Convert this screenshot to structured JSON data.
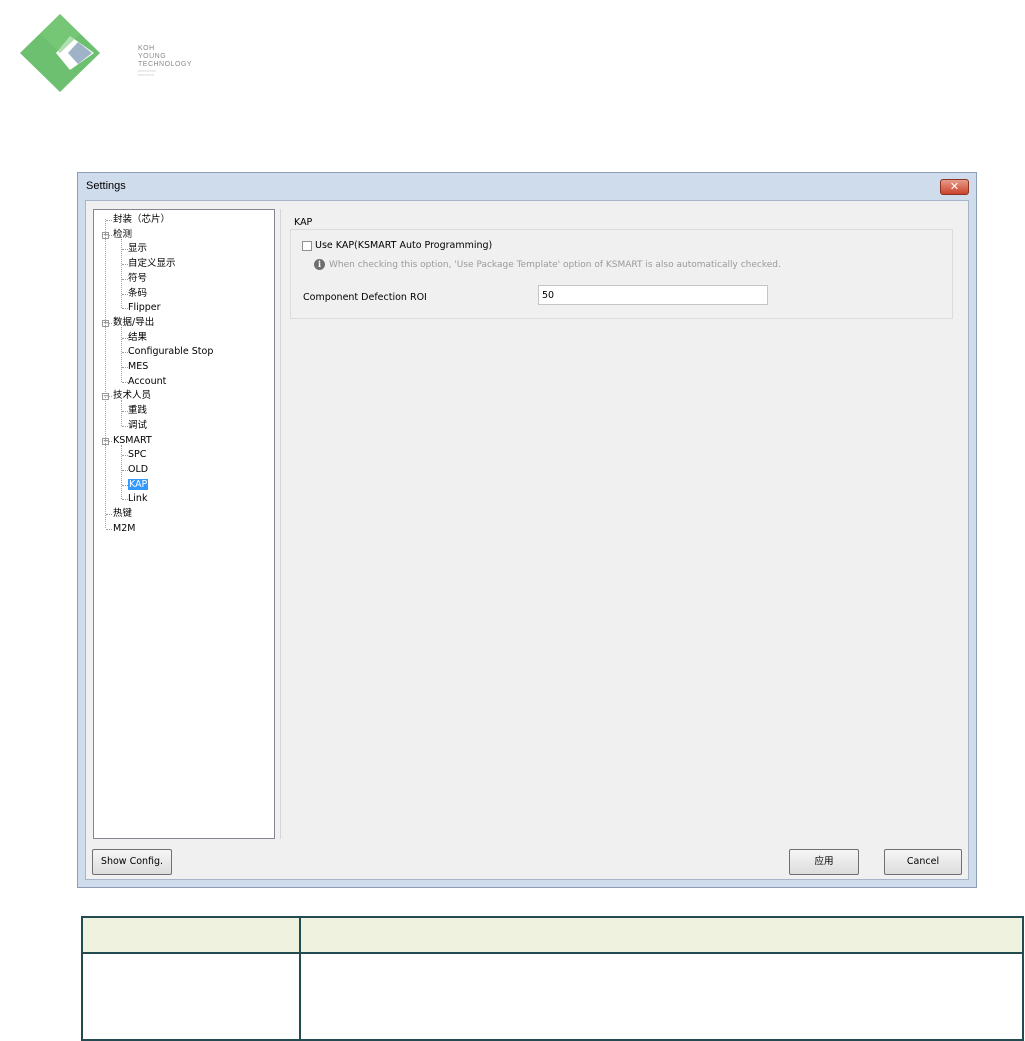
{
  "logo": {
    "lines": [
      "KOH",
      "YOUNG",
      "TECHNOLOGY"
    ],
    "colors": {
      "green": "#6cc06f",
      "dark_green": "#4fa85a",
      "gray": "#8a8a8a"
    }
  },
  "window": {
    "title": "Settings",
    "close_symbol": "✕"
  },
  "tree": {
    "items": [
      {
        "label": "封装（芯片）",
        "level": 0,
        "expandable": false
      },
      {
        "label": "检测",
        "level": 0,
        "expandable": true
      },
      {
        "label": "显示",
        "level": 1
      },
      {
        "label": "自定义显示",
        "level": 1
      },
      {
        "label": "符号",
        "level": 1
      },
      {
        "label": "条码",
        "level": 1
      },
      {
        "label": "Flipper",
        "level": 1
      },
      {
        "label": "数据/导出",
        "level": 0,
        "expandable": true
      },
      {
        "label": "结果",
        "level": 1
      },
      {
        "label": "Configurable Stop",
        "level": 1
      },
      {
        "label": "MES",
        "level": 1
      },
      {
        "label": "Account",
        "level": 1
      },
      {
        "label": "技术人员",
        "level": 0,
        "expandable": true
      },
      {
        "label": "重践",
        "level": 1
      },
      {
        "label": "调试",
        "level": 1
      },
      {
        "label": "KSMART",
        "level": 0,
        "expandable": true
      },
      {
        "label": "SPC",
        "level": 1
      },
      {
        "label": "OLD",
        "level": 1
      },
      {
        "label": "KAP",
        "level": 1,
        "selected": true
      },
      {
        "label": "Link",
        "level": 1
      },
      {
        "label": "热键",
        "level": 0,
        "expandable": false
      },
      {
        "label": "M2M",
        "level": 0,
        "expandable": false
      }
    ],
    "toggle_symbol": "−"
  },
  "panel": {
    "group_title": "KAP",
    "use_kap_label": "Use KAP(KSMART Auto Programming)",
    "use_kap_checked": false,
    "info_icon": "i",
    "info_text": "When checking this option, 'Use Package Template' option of KSMART is also automatically checked.",
    "roi_label": "Component Defection ROI",
    "roi_value": "50"
  },
  "buttons": {
    "show_config": "Show Config.",
    "apply": "应用",
    "cancel": "Cancel"
  },
  "colors": {
    "window_frame": "#cfdcec",
    "selection": "#3399ff",
    "table_header": "#eef2df",
    "table_border": "#244a52"
  }
}
